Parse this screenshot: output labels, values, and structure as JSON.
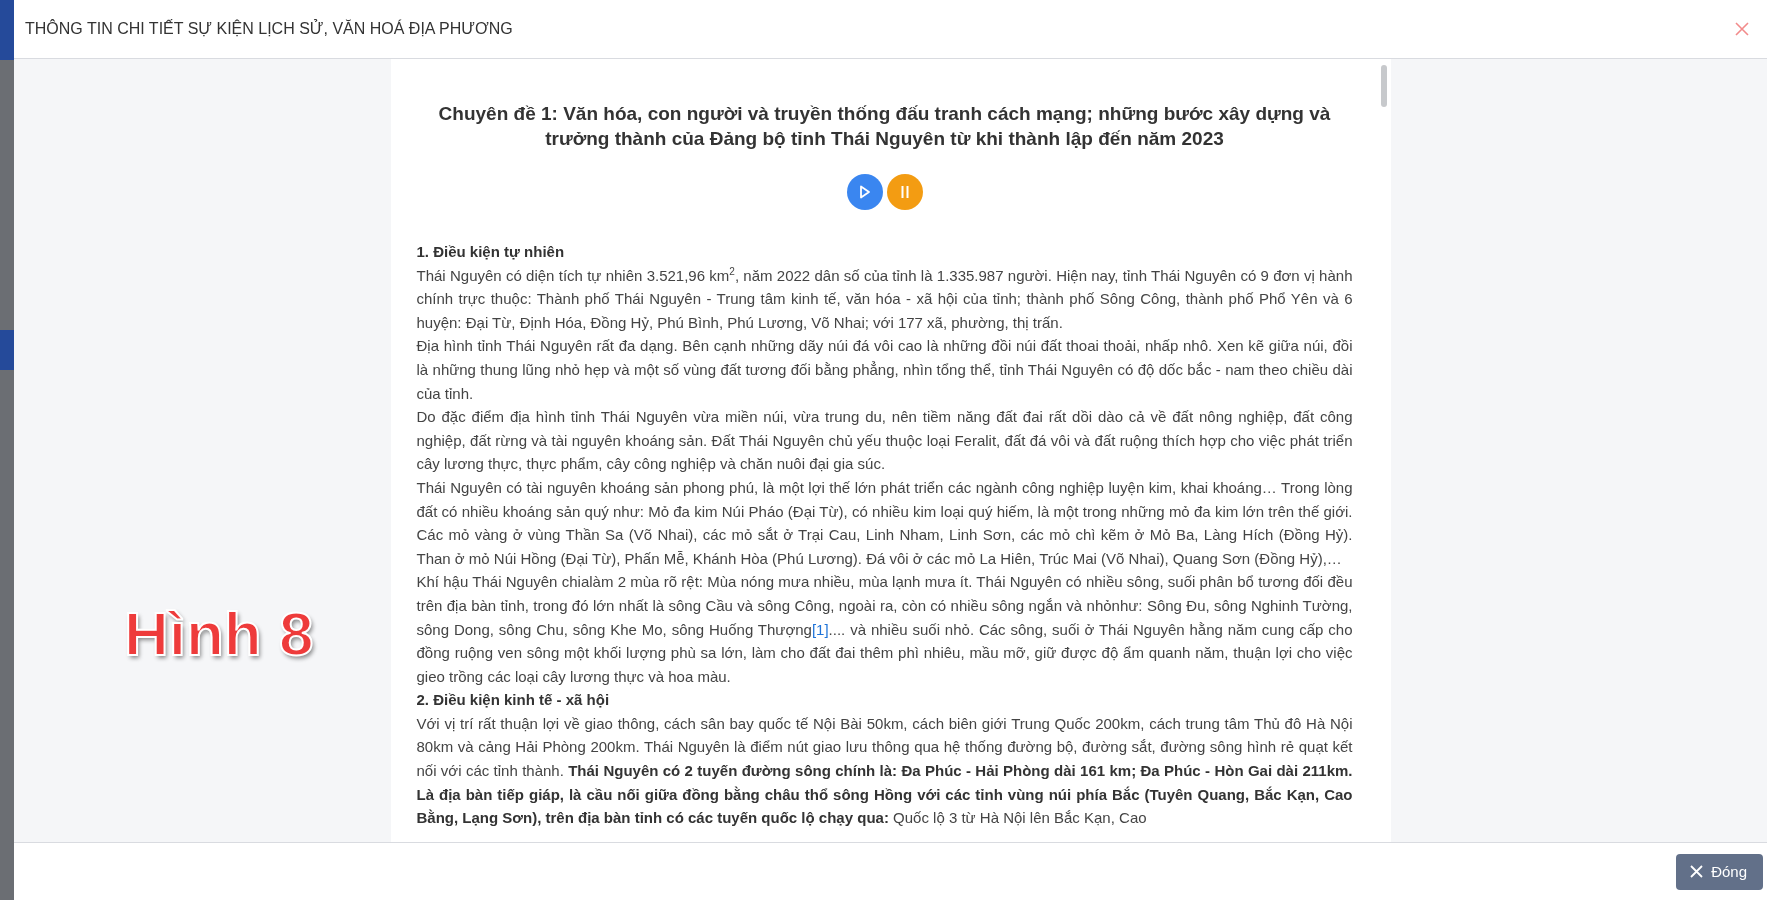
{
  "dialog": {
    "title": "THÔNG TIN CHI TIẾT SỰ KIỆN LỊCH SỬ, VĂN HOÁ ĐỊA PHƯƠNG"
  },
  "article": {
    "title": "Chuyên đề 1: Văn hóa, con người và truyền thống đấu tranh cách mạng; những bước xây dựng và trưởng thành của Đảng bộ tỉnh Thái Nguyên từ khi thành lập đến năm 2023",
    "audio_controls": [
      {
        "kind": "play"
      },
      {
        "kind": "pause"
      }
    ],
    "blocks": [
      {
        "kind": "heading",
        "text": "1. Điều kiện tự nhiên"
      },
      {
        "kind": "paragraph",
        "segments": [
          {
            "kind": "text",
            "text": "Thái Nguyên có diện tích tự nhiên 3.521,96 km$^{2}$, năm 2022 dân số của tỉnh là 1.335.987 người. Hiện nay, tỉnh Thái Nguyên có 9 đơn vị hành chính trực thuộc: Thành phố Thái Nguyên - Trung tâm kinh tế, văn hóa - xã hội của tỉnh; thành phố Sông Công, thành phố Phổ Yên và 6 huyện: Đại Từ, Định Hóa, Đồng Hỷ, Phú Bình, Phú Lương, Võ Nhai; với 177 xã, phường, thị trấn."
          }
        ]
      },
      {
        "kind": "paragraph",
        "segments": [
          {
            "kind": "text",
            "text": "Địa hình tỉnh Thái Nguyên rất đa dạng. Bên cạnh những dãy núi đá vôi cao là những đồi núi đất thoai thoải, nhấp nhô. Xen kẽ giữa núi, đồi là những thung lũng nhỏ hẹp và một số vùng đất tương đối bằng phẳng, nhìn tổng thể, tỉnh Thái Nguyên có độ dốc bắc - nam theo chiều dài của tỉnh."
          }
        ]
      },
      {
        "kind": "paragraph",
        "segments": [
          {
            "kind": "text",
            "text": "Do đặc điểm địa hình tỉnh Thái Nguyên vừa miền núi, vừa trung du, nên tiềm năng đất đai rất dồi dào cả về đất nông nghiệp, đất công nghiệp, đất rừng và tài nguyên khoáng sản. Đất Thái Nguyên chủ yếu thuộc loại Feralit, đất đá vôi và đất ruộng thích hợp cho việc phát triển cây lương thực, thực phẩm, cây công nghiệp và chăn nuôi đại gia súc."
          }
        ]
      },
      {
        "kind": "paragraph",
        "segments": [
          {
            "kind": "text",
            "text": "Thái Nguyên có tài nguyên khoáng sản phong phú, là một lợi thế lớn phát triển các ngành công nghiệp luyện kim, khai khoáng… Trong lòng đất có nhiều khoáng sản quý như: Mỏ đa kim Núi Pháo (Đại Từ), có nhiều kim loại quý hiếm, là một trong những mỏ đa kim lớn trên thế giới. Các mỏ vàng ở vùng Thần Sa (Võ Nhai), các mỏ sắt ở Trại Cau, Linh Nham, Linh Sơn, các mỏ chì kẽm ở Mỏ Ba, Làng Hích (Đồng Hỷ). Than ở mỏ Núi Hồng (Đại Từ), Phấn Mễ, Khánh Hòa (Phú Lương). Đá vôi ở các mỏ La Hiên, Trúc Mai (Võ Nhai), Quang Sơn (Đồng Hỷ),…"
          }
        ]
      },
      {
        "kind": "paragraph",
        "segments": [
          {
            "kind": "text",
            "text": "Khí hậu Thái Nguyên chialàm 2 mùa rõ rệt: Mùa nóng mưa nhiều, mùa lạnh mưa ít. Thái Nguyên có nhiều sông, suối phân bổ tương đối đều trên địa bàn tỉnh, trong đó lớn nhất là sông Cầu và sông Công, ngoài ra, còn có nhiều sông ngắn và nhỏnhư: Sông Đu, sông Nghinh Tường, sông Dong, sông Chu, sông Khe Mo, sông Huống Thượng"
          },
          {
            "kind": "link",
            "text": "[1]"
          },
          {
            "kind": "text",
            "text": ".... và nhiều suối nhỏ. Các sông, suối ở Thái Nguyên hằng năm cung cấp cho đồng ruộng ven sông một khối lượng phù sa lớn, làm cho đất đai thêm phì nhiêu, mầu mỡ, giữ được độ ẩm quanh năm, thuận lợi cho việc gieo trồng các loại cây lương thực và hoa màu."
          }
        ]
      },
      {
        "kind": "heading",
        "text": "2. Điều kiện kinh tế - xã hội"
      },
      {
        "kind": "paragraph",
        "segments": [
          {
            "kind": "text",
            "text": "Với vị trí rất thuận lợi về giao thông, cách sân bay quốc tế Nội Bài 50km, cách biên giới Trung Quốc 200km, cách trung tâm Thủ đô Hà Nội 80km và cảng Hải Phòng 200km. Thái Nguyên là điểm nút giao lưu thông qua hệ thống đường bộ, đường sắt, đường sông hình rẻ quạt kết nối với các tỉnh thành. **Thái Nguyên có 2 tuyến đường sông chính là: Đa Phúc - Hải Phòng dài 161 km; Đa Phúc - Hòn Gai dài 211km. Là địa bàn tiếp giáp, là cầu nối giữa đồng bằng châu thổ sông Hồng với các tỉnh vùng núi phía Bắc (Tuyên Quang, Bắc Kạn, Cao Bằng, Lạng Sơn), trên địa bàn tỉnh có các tuyến quốc lộ chạy qua:** Quốc lộ 3 từ Hà Nội lên Bắc Kạn, Cao"
          }
        ]
      }
    ]
  },
  "overlay_label": "Hình 8",
  "footer": {
    "close_button": "Đóng"
  }
}
